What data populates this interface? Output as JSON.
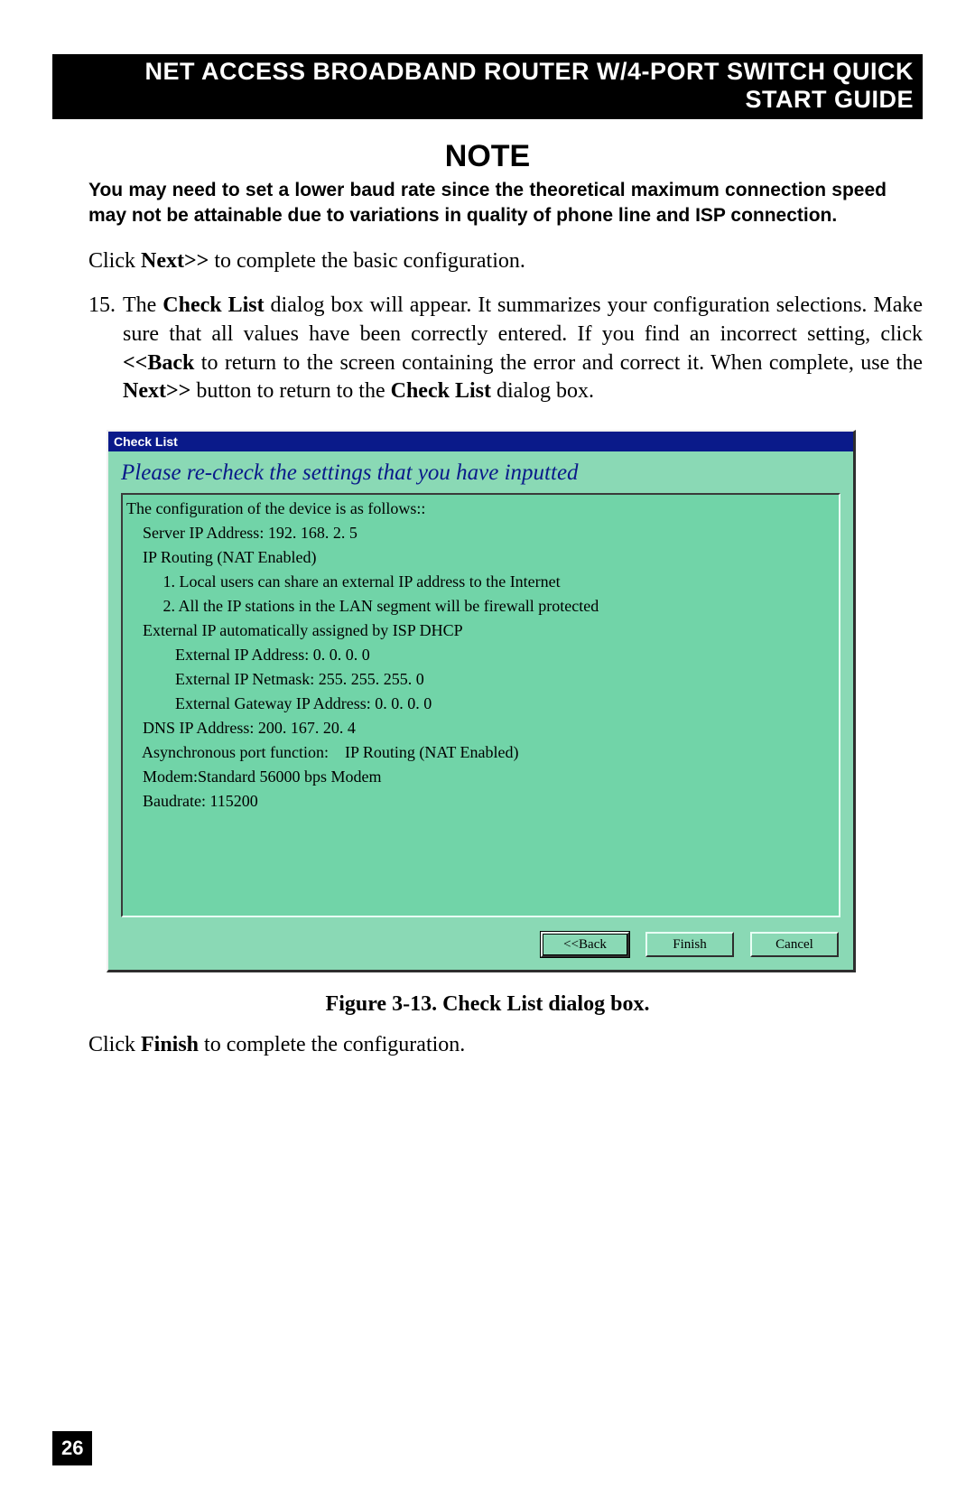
{
  "header": {
    "title": "NET ACCESS BROADBAND ROUTER W/4-PORT SWITCH QUICK START GUIDE"
  },
  "note": {
    "heading": "NOTE",
    "body": "You may need to set a lower baud rate since the theoretical maximum connection speed may not be attainable due to variations in quality of phone line and ISP connection."
  },
  "click_next": {
    "pre": "Click ",
    "bold": "Next>>",
    "post": " to complete the basic configuration."
  },
  "step15": {
    "num": "15.",
    "t1": "The ",
    "b1": "Check List",
    "t2": " dialog box will appear. It summarizes your configuration selections. Make sure that all values have been correctly entered. If you find an incorrect setting, click ",
    "b2": "<<Back",
    "t3": " to return to the screen containing the error and correct it. When complete, use the ",
    "b3": "Next>>",
    "t4": " button to return to the ",
    "b4": "Check List",
    "t5": " dialog box."
  },
  "dialog": {
    "title": "Check List",
    "heading": "Please re-check the settings that you have inputted",
    "lines": {
      "l0": "The configuration of the device is as follows::",
      "l1": "    Server IP Address: 192. 168. 2. 5",
      "l2": "    IP Routing (NAT Enabled)",
      "l3": "         1. Local users can share an external IP address to the Internet",
      "l4": "         2. All the IP stations in the LAN segment will be firewall protected",
      "l5": "    External IP automatically assigned by ISP DHCP",
      "l6": "            External IP Address: 0. 0. 0. 0",
      "l7": "            External IP Netmask: 255. 255. 255. 0",
      "l8": "            External Gateway IP Address: 0. 0. 0. 0",
      "l9": "    DNS IP Address: 200. 167. 20. 4",
      "l10": "    Asynchronous port function:    IP Routing (NAT Enabled)",
      "l11": "    Modem:Standard 56000 bps Modem",
      "l12": "    Baudrate: 115200"
    },
    "buttons": {
      "back": "<<Back",
      "finish": "Finish",
      "cancel": "Cancel"
    }
  },
  "figure_caption": "Figure 3-13. Check List dialog box.",
  "finish_line": {
    "pre": "Click ",
    "bold": "Finish",
    "post": " to complete the configuration."
  },
  "page_number": "26"
}
